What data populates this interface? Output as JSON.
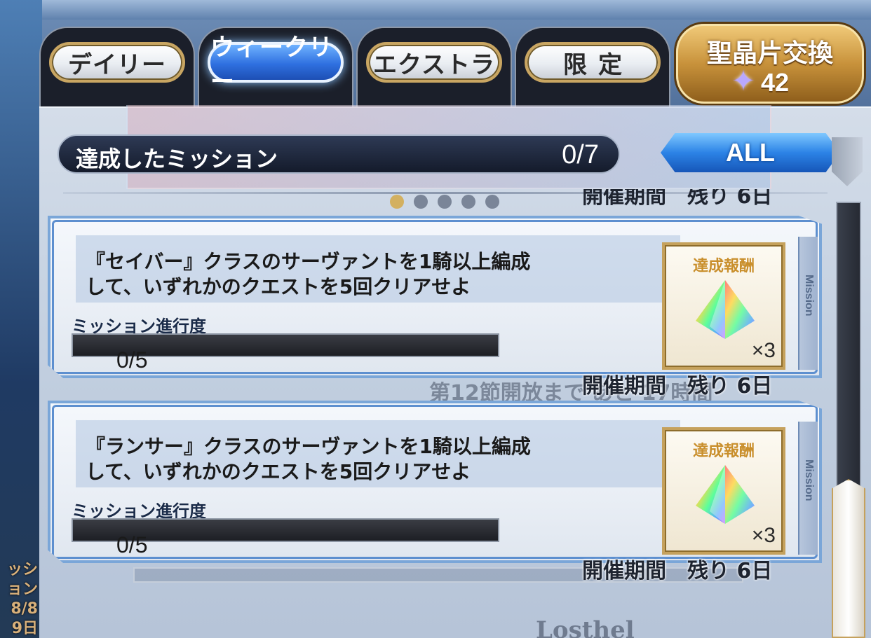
{
  "tabs": [
    {
      "label": "デイリー",
      "active": false
    },
    {
      "label": "ウィークリー",
      "active": true
    },
    {
      "label": "エクストラ",
      "active": false
    },
    {
      "label": "限定",
      "active": false
    }
  ],
  "exchange": {
    "title": "聖晶片交換",
    "icon": "star-icon",
    "count": "42"
  },
  "achieved": {
    "label": "達成したミッション",
    "value": "0/7"
  },
  "filter": {
    "label": "ALL"
  },
  "background": {
    "side_text": "ッション\n8/8\n9日",
    "ghost_text": "第12節開放まで あと 17時間",
    "ghost_bottom": "Losthel"
  },
  "top_period": "開催期間　残り 6日",
  "page_indicator": {
    "count": 5,
    "active_index": 0
  },
  "missions": [
    {
      "desc_line1": "『セイバー』クラスのサーヴァントを1騎以上編成",
      "desc_line2": "して、いずれかのクエストを5回クリアせよ",
      "progress_label": "ミッション進行度",
      "progress_text": "0/5",
      "progress_fraction": 0,
      "reward_title": "達成報酬",
      "reward_icon": "saint-quartz-fragment-icon",
      "reward_qty": "×3",
      "side_label": "Mission",
      "period": "開催期間　残り 6日"
    },
    {
      "desc_line1": "『ランサー』クラスのサーヴァントを1騎以上編成",
      "desc_line2": "して、いずれかのクエストを5回クリアせよ",
      "progress_label": "ミッション進行度",
      "progress_text": "0/5",
      "progress_fraction": 0,
      "reward_title": "達成報酬",
      "reward_icon": "saint-quartz-fragment-icon",
      "reward_qty": "×3",
      "side_label": "Mission",
      "period": "開催期間　残り 6日"
    }
  ],
  "colors": {
    "accent_blue": "#2f70e0",
    "gold": "#c5a15c",
    "panel": "#c1cedf"
  }
}
